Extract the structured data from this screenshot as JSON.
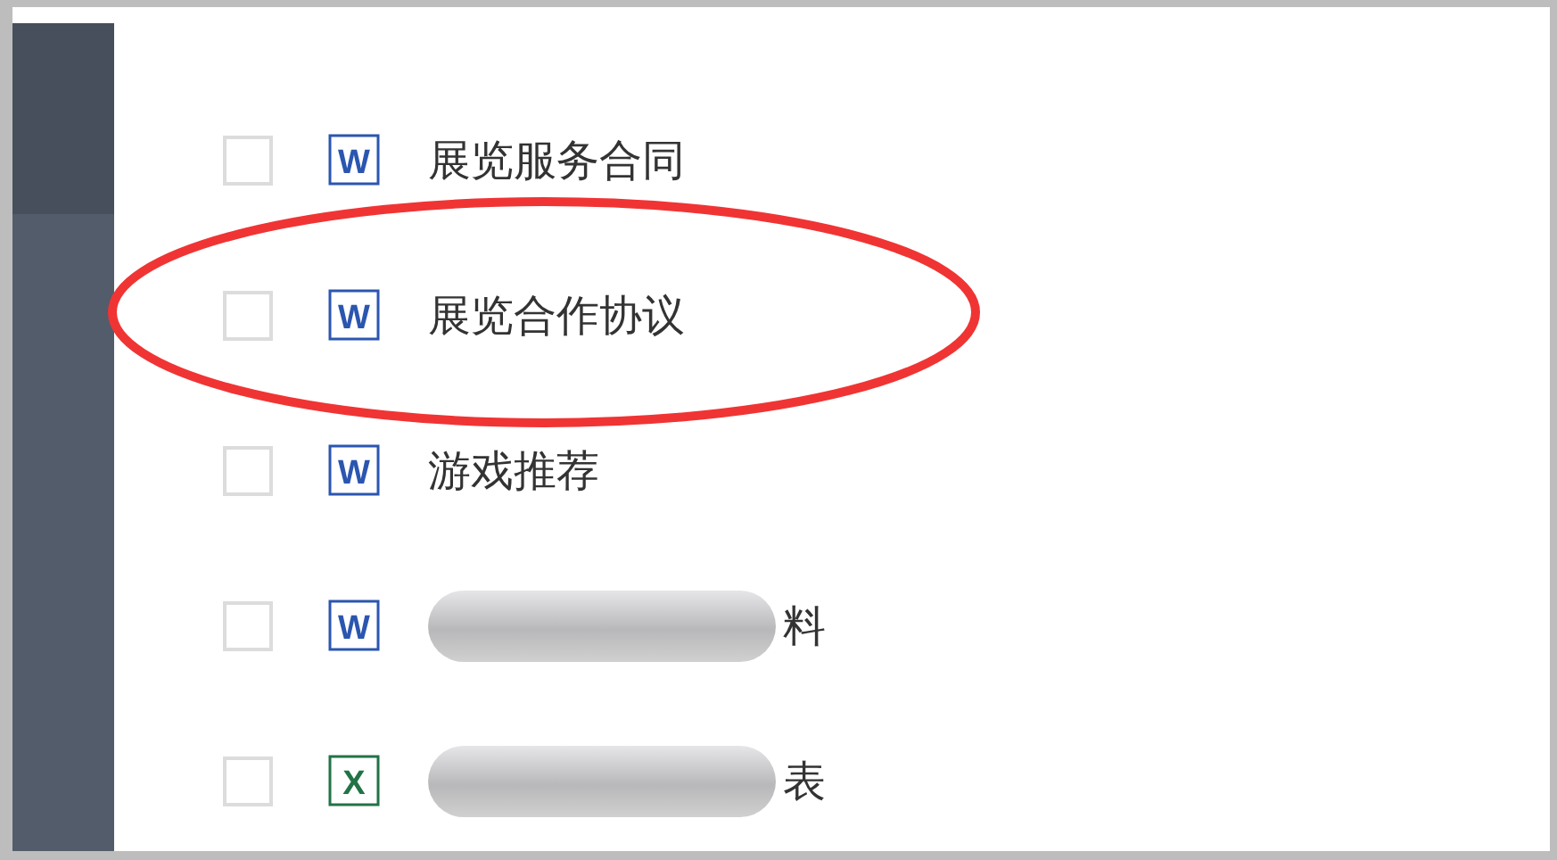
{
  "files": [
    {
      "kind": "word",
      "icon_label": "W",
      "checked": false,
      "circled": false,
      "name": "展览服务合同"
    },
    {
      "kind": "word",
      "icon_label": "W",
      "checked": false,
      "circled": true,
      "name": "展览合作协议"
    },
    {
      "kind": "word",
      "icon_label": "W",
      "checked": false,
      "circled": false,
      "name": "游戏推荐"
    },
    {
      "kind": "word",
      "icon_label": "W",
      "checked": false,
      "circled": false,
      "redacted": true,
      "name": "料"
    },
    {
      "kind": "excel",
      "icon_label": "X",
      "checked": false,
      "circled": false,
      "redacted": true,
      "name": "表"
    }
  ]
}
